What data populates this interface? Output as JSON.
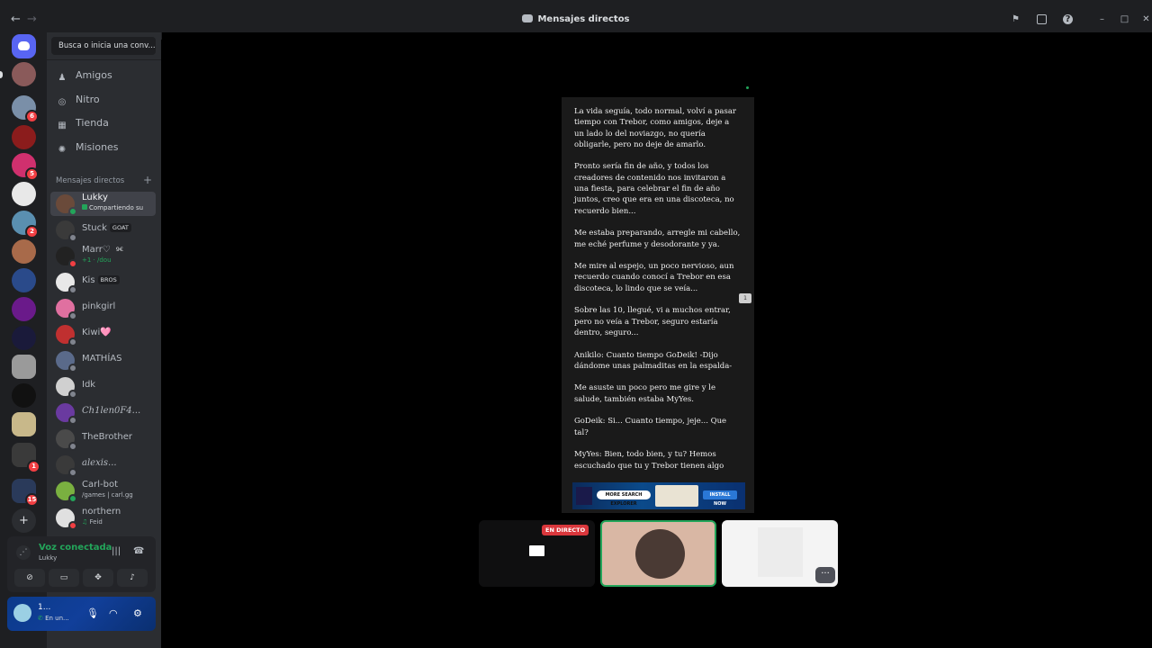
{
  "titlebar": {
    "title": "Mensajes directos",
    "back": "←",
    "forward": "→"
  },
  "badges": [
    "6",
    "5",
    "2",
    "1",
    "15"
  ],
  "search": {
    "placeholder": "Busca o inicia una conv..."
  },
  "nav": [
    {
      "label": "Amigos"
    },
    {
      "label": "Nitro"
    },
    {
      "label": "Tienda"
    },
    {
      "label": "Misiones"
    }
  ],
  "dm_header": "Mensajes directos",
  "dms": [
    {
      "name": "Lukky",
      "sub": "Compartiendo su"
    },
    {
      "name": "Stuck",
      "tag": "GOAT"
    },
    {
      "name": "Marr♡",
      "tag": "9€",
      "sub": "+1 · /dou"
    },
    {
      "name": "Kis",
      "tag": "BROS"
    },
    {
      "name": "pinkgirl"
    },
    {
      "name": "Kiwi🩷"
    },
    {
      "name": "MATHÍAS"
    },
    {
      "name": "Idk"
    },
    {
      "name": "Ch1len0F4..."
    },
    {
      "name": "TheBrother"
    },
    {
      "name": "alexis..."
    },
    {
      "name": "Carl-bot",
      "sub": "/games | carl.gg"
    },
    {
      "name": "northern",
      "sub": "Feid"
    }
  ],
  "voice": {
    "status": "Voz conectada",
    "channel": "Lukky"
  },
  "user": {
    "name": "1...",
    "status": "En un..."
  },
  "story": [
    "La vida seguía, todo normal, volví a pasar tiempo con Trebor, como amigos, deje a un lado lo del noviazgo, no quería obligarle, pero no deje de amarlo.",
    "Pronto sería fin de año, y todos los creadores de contenido nos invitaron a una fiesta, para celebrar el fin de año juntos, creo que era en una discoteca, no recuerdo bien...",
    "Me estaba preparando, arregle mi cabello, me eché perfume y desodorante y ya.",
    "Me mire al espejo, un poco nervioso, aun recuerdo cuando conocí a Trebor en esa discoteca, lo lindo que se veía...",
    "Sobre las 10, llegué, vi a muchos entrar, pero no veía a Trebor, seguro estaría dentro, seguro...",
    "Anikilo: Cuanto tiempo GoDeik! -Dijo dándome unas palmaditas en la espalda-",
    "Me asuste un poco pero me gire y le salude, también estaba MyYes.",
    "GoDeik: Si... Cuanto tiempo, jeje... Que tal?",
    "MyYes: Bien, todo bien, y tu? Hemos escuchado que tu y Trebor tienen algo"
  ],
  "ad": {
    "search": "MORE SEARCH EXPLORER",
    "button": "INSTALL NOW"
  },
  "comment_count": "1",
  "live_label": "EN DIRECTO",
  "more": "···"
}
